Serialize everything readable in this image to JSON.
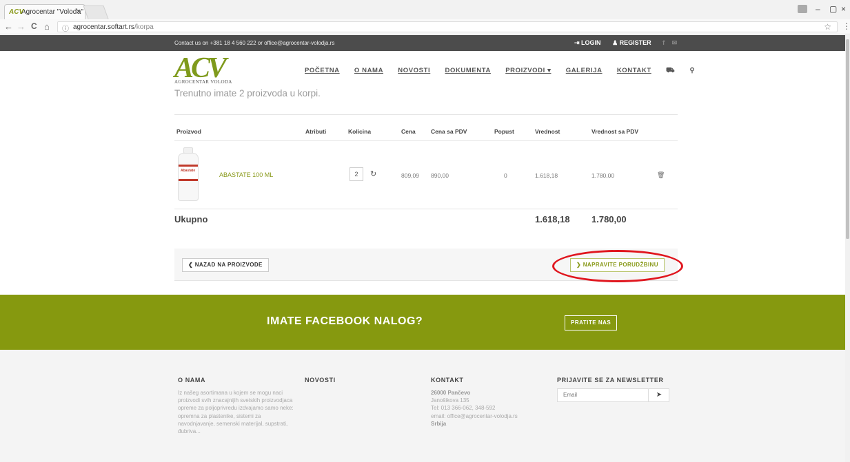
{
  "browser": {
    "tab_title": "Agrocentar \"Voloďa\"",
    "tab_close": "×",
    "url_host": "agrocentar.softart.rs",
    "url_path": "/korpa",
    "back": "←",
    "forward": "→",
    "reload": "C",
    "home": "⌂",
    "info": "ⓘ",
    "star": "☆",
    "menu": "⋮",
    "min": "–",
    "max": "▢",
    "close": "×"
  },
  "topbar": {
    "contact": "Contact us on +381 18 4 560 222 or office@agrocentar-volodja.rs",
    "login": "⇥ LOGIN",
    "register": "♟ REGISTER",
    "facebook": "f",
    "mail": "✉"
  },
  "logo": {
    "letters": "ACV",
    "sub": "AGROCENTAR VOLODA"
  },
  "nav": {
    "items": [
      "POČETNA",
      "O NAMA",
      "NOVOSTI",
      "DOKUMENTA",
      "PROIZVODI ▾",
      "GALERIJA",
      "KONTAKT"
    ],
    "cart_icon": "⛟",
    "search_icon": "⚲"
  },
  "cart": {
    "message": "Trenutno imate 2 proizvoda u korpi.",
    "headers": [
      "Proizvod",
      "Atributi",
      "Kolicina",
      "Cena",
      "Cena sa PDV",
      "Popust",
      "Vrednost",
      "Vrednost sa PDV"
    ],
    "item": {
      "bottle_label": "Abastate",
      "name": "ABASTATE 100 ML",
      "qty": "2",
      "price": "809,09",
      "price_vat": "890,00",
      "discount": "0",
      "value": "1.618,18",
      "value_vat": "1.780,00",
      "refresh_icon": "↻",
      "trash_icon": "🗑"
    },
    "total_label": "Ukupno",
    "total_value": "1.618,18",
    "total_value_vat": "1.780,00",
    "back_button": "❮ NAZAD NA PROIZVODE",
    "order_button": "❯ NAPRAVITE PORUDŽBINU"
  },
  "facebook": {
    "title": "IMATE FACEBOOK NALOG?",
    "button": "PRATITE NAS"
  },
  "footer": {
    "about_title": "O NAMA",
    "about_text": "Iz našeg asortimana u kojem se mogu naci proizvodi svih znacajnijih svetskih proizvodjaca opreme za poljoprivredu izdvajamo samo neke: opremna za plastenike, sistemi za navodnjavanje, semenski materijal, supstrati, đubriva...",
    "news_title": "NOVOSTI",
    "contact_title": "KONTAKT",
    "contact_city": "26000 Pančevo",
    "contact_street": "Janošikova 135",
    "contact_tel": "Tel: 013 366-062, 348-592",
    "contact_email": "email: office@agrocentar-volodja.rs",
    "contact_country": "Srbija",
    "newsletter_title": "PRIJAVITE SE ZA NEWSLETTER",
    "newsletter_placeholder": "Email",
    "send_icon": "➤"
  },
  "colors": {
    "brand_green": "#86990f",
    "highlight_red": "#e0161e",
    "topbar": "#4c4c4c"
  }
}
